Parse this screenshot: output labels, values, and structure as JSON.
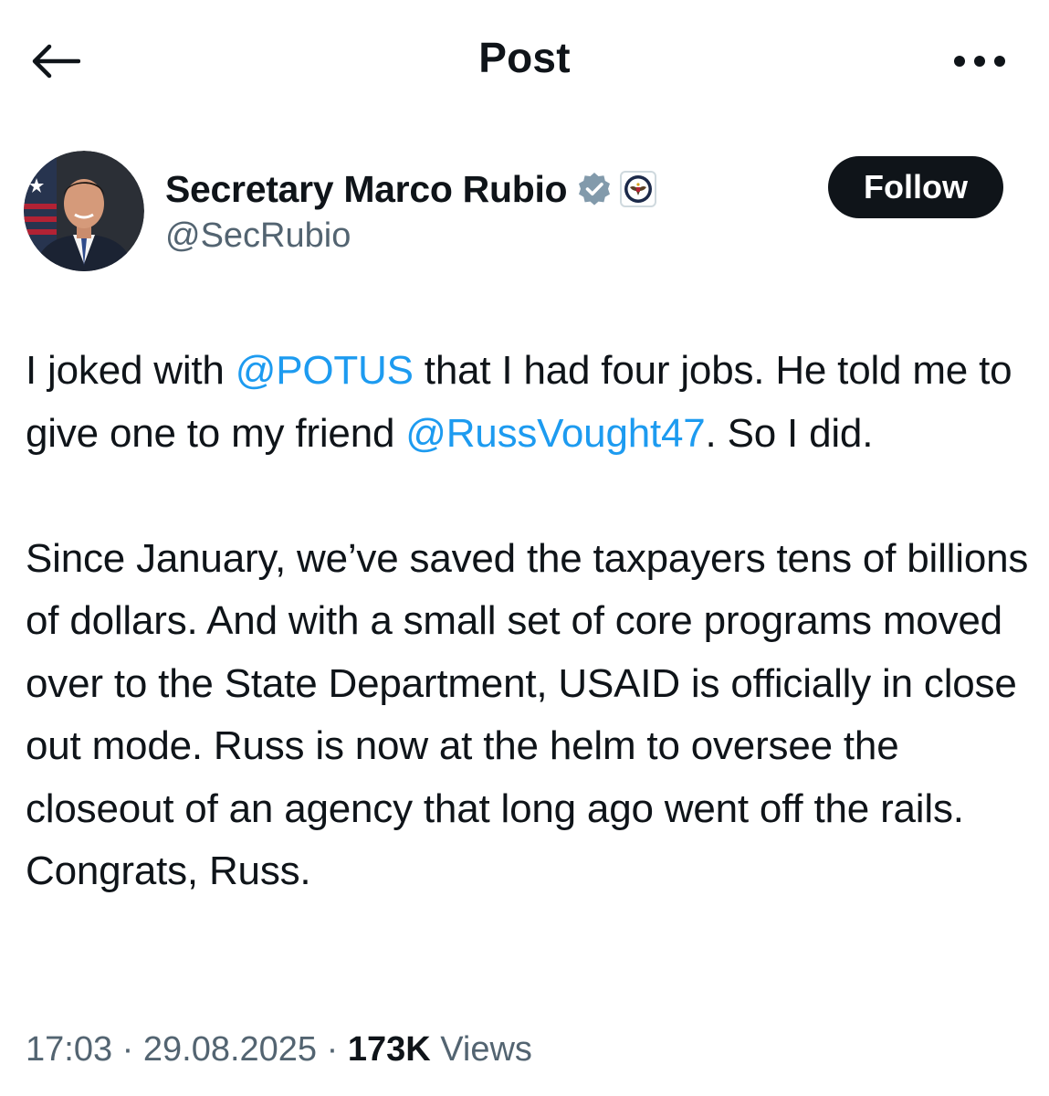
{
  "header": {
    "title": "Post"
  },
  "author": {
    "display_name": "Secretary Marco Rubio",
    "handle": "@SecRubio",
    "follow_label": "Follow",
    "verified_color": "#829aab"
  },
  "tweet": {
    "paragraph1": {
      "before1": "I joked with ",
      "mention1": "@POTUS",
      "middle": " that I had four jobs. He told me to give one to my friend ",
      "mention2": "@RussVought47",
      "after": ". So I did."
    },
    "paragraph2": "Since January, we’ve saved the taxpayers tens of billions of dollars. And with a small set of core programs moved over to the State Department, USAID is officially in close out mode. Russ is now at the helm to oversee the closeout of an agency that long ago went off the rails. Congrats, Russ."
  },
  "meta": {
    "time": "17:03",
    "separator": "·",
    "date": "29.08.2025",
    "views_count": "173K",
    "views_label": "Views"
  },
  "colors": {
    "link": "#1d9bf0",
    "secondary_text": "#536471",
    "primary_text": "#0f1419"
  },
  "icons": {
    "back": "arrow-left-icon",
    "more": "more-horizontal-icon",
    "verified": "verified-badge-icon",
    "affiliation": "state-department-seal-icon"
  }
}
